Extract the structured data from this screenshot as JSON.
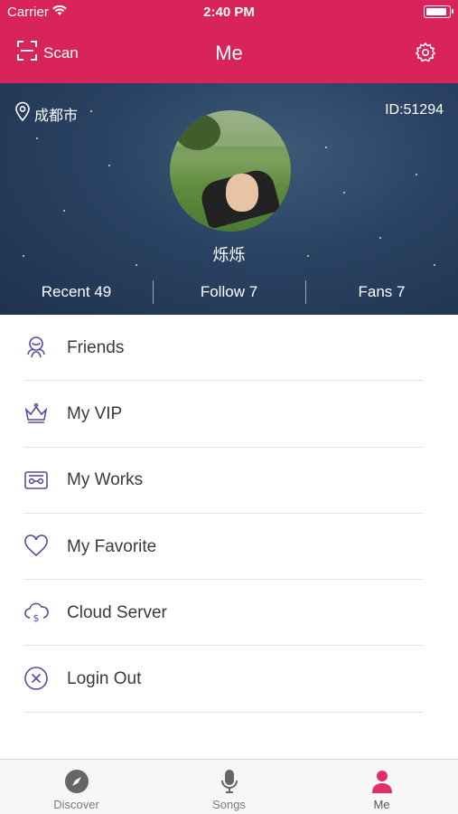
{
  "status_bar": {
    "carrier": "Carrier",
    "time": "2:40 PM"
  },
  "nav": {
    "scan_label": "Scan",
    "title": "Me"
  },
  "profile": {
    "location": "成都市",
    "user_id": "ID:51294",
    "nickname": "烁烁",
    "stats": [
      {
        "label": "Recent 49"
      },
      {
        "label": "Follow 7"
      },
      {
        "label": "Fans 7"
      }
    ]
  },
  "menu": {
    "items": [
      {
        "label": "Friends",
        "icon": "friends-icon"
      },
      {
        "label": "My VIP",
        "icon": "crown-icon"
      },
      {
        "label": "My Works",
        "icon": "cassette-icon"
      },
      {
        "label": "My Favorite",
        "icon": "heart-icon"
      },
      {
        "label": "Cloud Server",
        "icon": "cloud-money-icon"
      },
      {
        "label": "Login Out",
        "icon": "close-circle-icon"
      }
    ]
  },
  "tabbar": {
    "tabs": [
      {
        "label": "Discover",
        "icon": "compass-icon",
        "active": false
      },
      {
        "label": "Songs",
        "icon": "microphone-icon",
        "active": false
      },
      {
        "label": "Me",
        "icon": "person-icon",
        "active": true
      }
    ]
  },
  "colors": {
    "brand": "#d8245a",
    "menu_icon": "#5a4aa0",
    "tab_active": "#e0306a",
    "tab_inactive": "#666666"
  }
}
